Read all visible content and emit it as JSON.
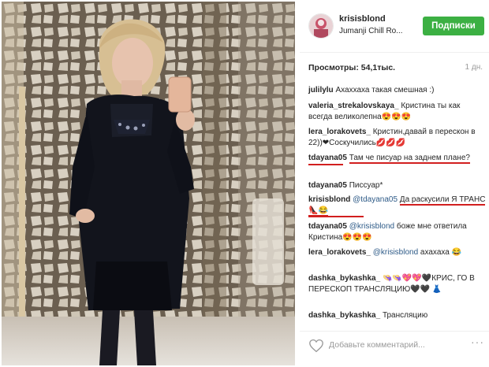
{
  "post": {
    "username": "krisisblond",
    "location": "Jumanji Chill Ro...",
    "follow_label": "Подписки",
    "views": "Просмотры: 54,1тыс.",
    "age": "1 дн.",
    "more_label": "···"
  },
  "comments": [
    {
      "user": "julilylu",
      "text": "Ахаххаха такая смешная :)"
    },
    {
      "user": "valeria_strekalovskaya_",
      "text": "Кристина ты как всегда великолепна😍😍😍"
    },
    {
      "user": "lera_lorakovets_",
      "text": "Кристин,давай в перескон в 22))❤Соскучились💋💋💋"
    },
    {
      "user": "tdayana05",
      "text": "Там че писуар на заднем плане?"
    },
    {
      "user": "tdayana05",
      "text": "Писсуар*"
    },
    {
      "user": "krisisblond",
      "mention": "@tdayana05",
      "text": "Да раскусили Я ТРАНС 👠😂"
    },
    {
      "user": "tdayana05",
      "mention": "@krisisblond",
      "text": "боже мне ответила Кристина😍😍😍"
    },
    {
      "user": "lera_lorakovets_",
      "mention": "@krisisblond",
      "text": "ахахаха 😂"
    },
    {
      "user": "dashka_bykashka_",
      "text": "👒👒💖💖🖤КРИС, ГО В ПЕРЕСКОП ТРАНСЛЯЦИЮ🖤🖤 👗"
    },
    {
      "user": "dashka_bykashka_",
      "text": "Трансляцию"
    }
  ],
  "comment_box": {
    "placeholder": "Добавьте комментарий..."
  },
  "colors": {
    "follow_button": "#3cb043",
    "highlight_underline": "#d21f1f",
    "mention": "#2d5a87"
  },
  "icons": {
    "like": "heart-outline-icon",
    "more": "ellipsis-icon"
  }
}
